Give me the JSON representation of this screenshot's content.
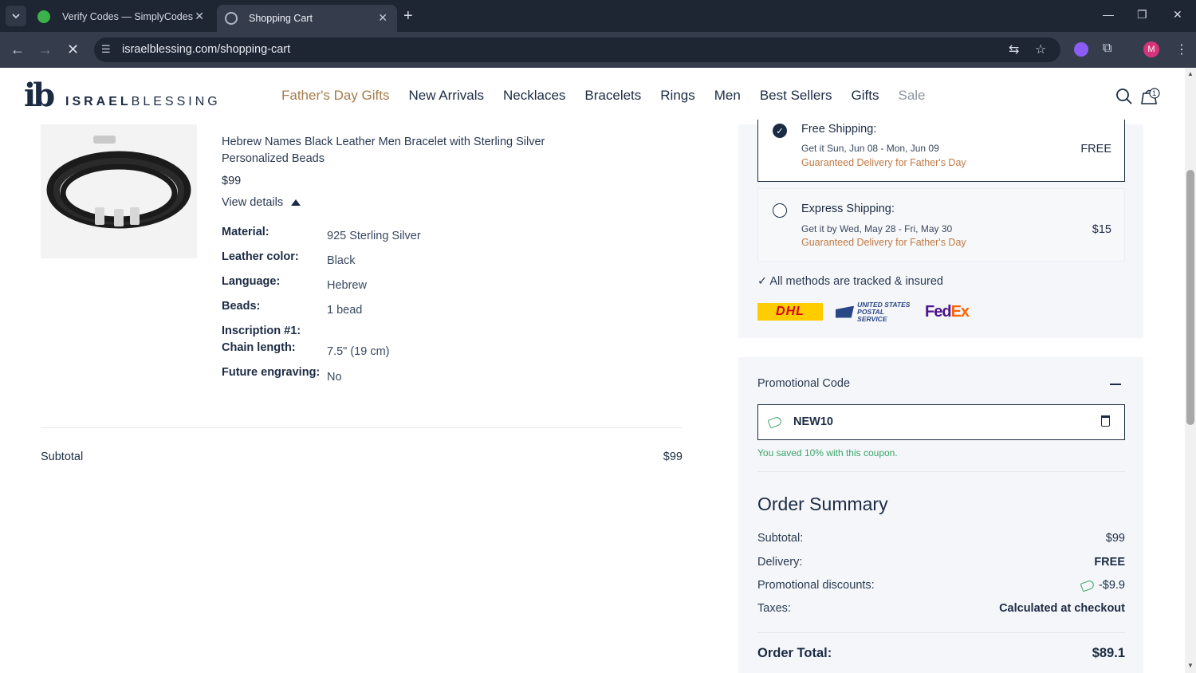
{
  "browser": {
    "tabs": [
      {
        "title": "Verify Codes — SimplyCodes",
        "active": false
      },
      {
        "title": "Shopping Cart",
        "active": true
      }
    ],
    "url": "israelblessing.com/shopping-cart"
  },
  "header": {
    "logo_mark": "ib",
    "logo_bold": "ISRAEL",
    "logo_light": "BLESSING",
    "nav": [
      "Father's Day Gifts",
      "New Arrivals",
      "Necklaces",
      "Bracelets",
      "Rings",
      "Men",
      "Best Sellers",
      "Gifts",
      "Sale"
    ],
    "cart_count": "1"
  },
  "product": {
    "title": "Hebrew Names Black Leather Men Bracelet with Sterling Silver Personalized Beads",
    "price": "$99",
    "view_details": "View details",
    "attributes": [
      {
        "label": "Material:",
        "value": "925 Sterling Silver"
      },
      {
        "label": "Leather color:",
        "value": "Black"
      },
      {
        "label": "Language:",
        "value": "Hebrew"
      },
      {
        "label": "Beads:",
        "value": "1 bead"
      },
      {
        "label": "Inscription #1:",
        "value": ""
      },
      {
        "label": "Chain length:",
        "value": "7.5\" (19 cm)"
      },
      {
        "label": "Future engraving:",
        "value": "No"
      }
    ]
  },
  "cart_subtotal": {
    "label": "Subtotal",
    "value": "$99"
  },
  "shipping": {
    "options": [
      {
        "title": "Free Shipping:",
        "date": "Get it Sun, Jun 08 - Mon, Jun 09",
        "guarantee": "Guaranteed Delivery for Father's Day",
        "price": "FREE",
        "selected": true
      },
      {
        "title": "Express Shipping:",
        "date": "Get it by Wed, May 28 - Fri, May 30",
        "guarantee": "Guaranteed Delivery for Father's Day",
        "price": "$15",
        "selected": false
      }
    ],
    "tracked_note": "All methods are tracked & insured",
    "carriers": {
      "dhl": "DHL",
      "usps_line1": "UNITED STATES",
      "usps_line2": "POSTAL SERVICE",
      "fedex_fe": "Fed",
      "fedex_ex": "Ex"
    }
  },
  "promo": {
    "heading": "Promotional Code",
    "code": "NEW10",
    "saved_message": "You saved 10% with this coupon."
  },
  "order_summary": {
    "title": "Order Summary",
    "rows": [
      {
        "label": "Subtotal:",
        "value": "$99"
      },
      {
        "label": "Delivery:",
        "value": "FREE"
      },
      {
        "label": "Promotional discounts:",
        "value": "-$9.9"
      },
      {
        "label": "Taxes:",
        "value": "Calculated at checkout"
      }
    ],
    "total_label": "Order Total:",
    "total_value": "$89.1"
  },
  "colors": {
    "navy": "#1c2b44",
    "gold": "#a57c4b",
    "orange": "#c07a45",
    "green": "#3aa46a",
    "panel": "#f4f6f9"
  }
}
